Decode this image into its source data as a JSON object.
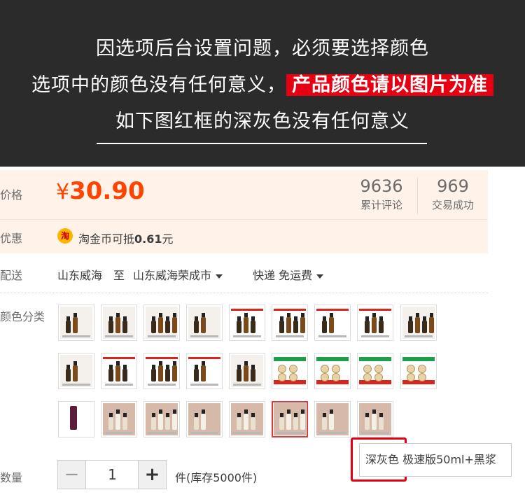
{
  "banner": {
    "line1": "因选项后台设置问题，必须要选择颜色",
    "line2_prefix": "选项中的颜色没有任何意义，",
    "line2_highlight": "产品颜色请以图片为准",
    "line3": "如下图红框的深灰色没有任何意义",
    "highlight_color": "#e60012"
  },
  "price": {
    "label": "价格",
    "currency": "¥",
    "value": "30.90",
    "stats": [
      {
        "number": "9636",
        "text": "累计评论"
      },
      {
        "number": "969",
        "text": "交易成功"
      }
    ]
  },
  "promo": {
    "label": "优惠",
    "icon": "taobao-coin-icon",
    "icon_char": "淘",
    "text_prefix": "淘金币可抵",
    "amount": "0.61",
    "text_suffix": "元"
  },
  "shipping": {
    "label": "配送",
    "from": "山东威海",
    "to_word": "至",
    "to": "山东威海荣成市",
    "method": "快递",
    "fee": "免运费"
  },
  "color": {
    "label": "颜色分类",
    "selected_index": 23,
    "tooltip_color": "深灰色",
    "tooltip_name": "极速版50ml+黑浆"
  },
  "quantity": {
    "label": "数量",
    "minus": "−",
    "value": "1",
    "plus": "+",
    "stock": "件(库存5000件)"
  },
  "colors": {
    "accent": "#ff4400",
    "selected_border": "#e4393c"
  }
}
